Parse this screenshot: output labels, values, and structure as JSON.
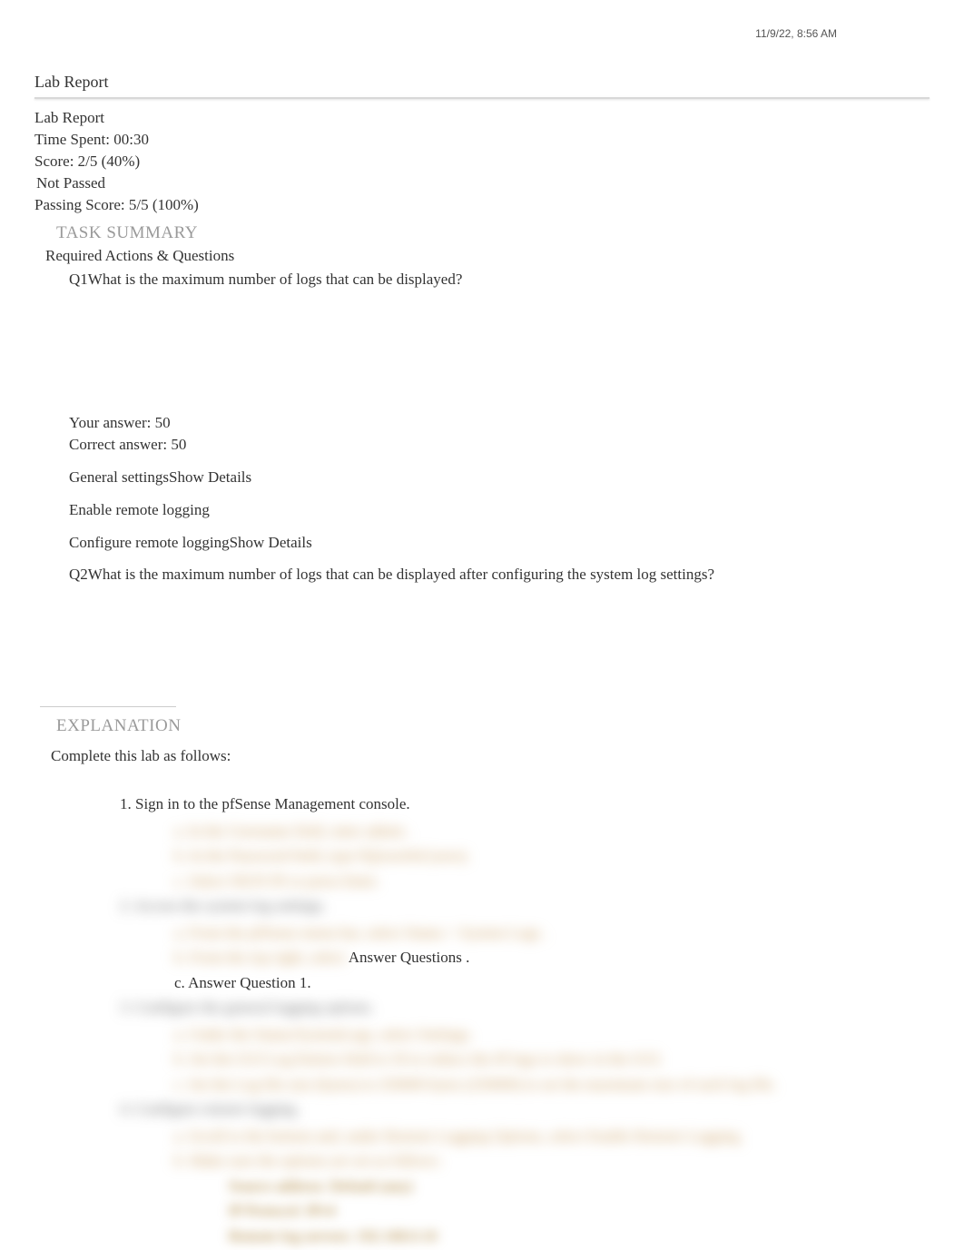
{
  "timestamp": "11/9/22, 8:56 AM",
  "title": "Lab Report",
  "header": {
    "report_label": "Lab Report",
    "time_spent": "Time Spent: 00:30",
    "score": "Score: 2/5 (40%)",
    "not_passed": "Not Passed",
    "passing_score": "Passing Score: 5/5 (100%)"
  },
  "task_summary_label": "TASK SUMMARY",
  "required_actions_label": "Required Actions & Questions",
  "q1": {
    "label": "Q1",
    "text": "What is the maximum number of logs that can be displayed?",
    "your_answer": "Your answer: 50",
    "correct_answer": "Correct answer: 50"
  },
  "general_settings": "General settings",
  "show_details": "Show Details",
  "enable_remote": "Enable remote logging",
  "configure_remote": "Configure remote logging",
  "q2": {
    "label": "Q2",
    "text": "What is the maximum number of logs that can be displayed after configuring the system log settings?"
  },
  "explanation_label": "EXPLANATION",
  "explanation_intro": "Complete this lab as follows:",
  "steps": {
    "step1_num": "1.",
    "step1_text": "Sign in to the pfSense Management console.",
    "step1a": "a. In the Username field, enter admin .",
    "step1b": "b. In the Password field, type P@ssw0rd (zero).",
    "step1c": "c. Select SIGN IN or press Enter.",
    "step2": "2. Access the system log settings.",
    "step2a": "a. From the pfSense menu bar, select Status > System Logs .",
    "step2b_prefix": "b. From the top right, select",
    "step2b_answer": "Answer Questions",
    "step2b_suffix": ".",
    "step2c": "c. Answer Question 1.",
    "step3": "3. Configure the general logging options.",
    "step3a": "a. Under the Status/SystemLogs, select Settings.",
    "step3b": "b. Set the GUI Log Entries field to 50 to reduce the #f logs to show in the GUI.",
    "step3c": "c. Set the Log file size (bytes) to 250000 bytes (250000) to set the maximum size of each log file.",
    "step4": "4. Configure remote logging.",
    "step4a": "a. Scroll to the bottom and, under Remote Logging Options, select Enable Remote Logging.",
    "step4b": "b. Make sure the options are set as follows:",
    "step4b1": "Source address: Default (any)",
    "step4b2": "IP Protocol: IPv4",
    "step4b3": "Remote log servers: 192.168.0.10"
  }
}
